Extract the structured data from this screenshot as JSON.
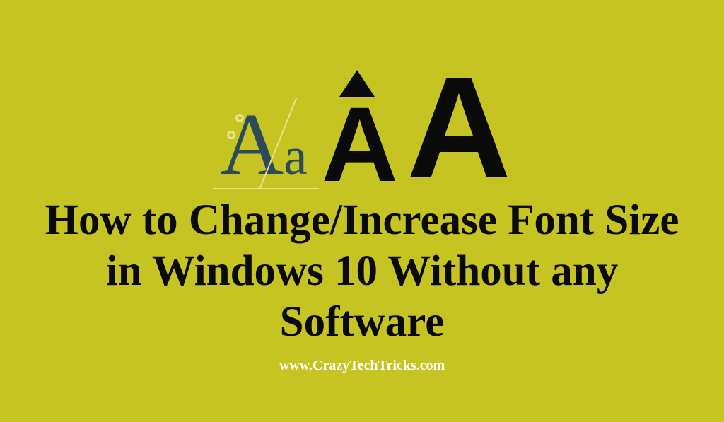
{
  "graphic": {
    "serif_big": "A",
    "serif_small": "a",
    "bold_mid": "A",
    "bold_large": "A"
  },
  "headline": "How to Change/Increase Font Size in Windows 10 Without any Software",
  "site_url": "www.CrazyTechTricks.com",
  "colors": {
    "background": "#c6c422",
    "headline": "#0a0a0a",
    "serif_letters": "#2b4b5a",
    "url": "#ffffff",
    "guide_lines": "#e8e68a"
  }
}
